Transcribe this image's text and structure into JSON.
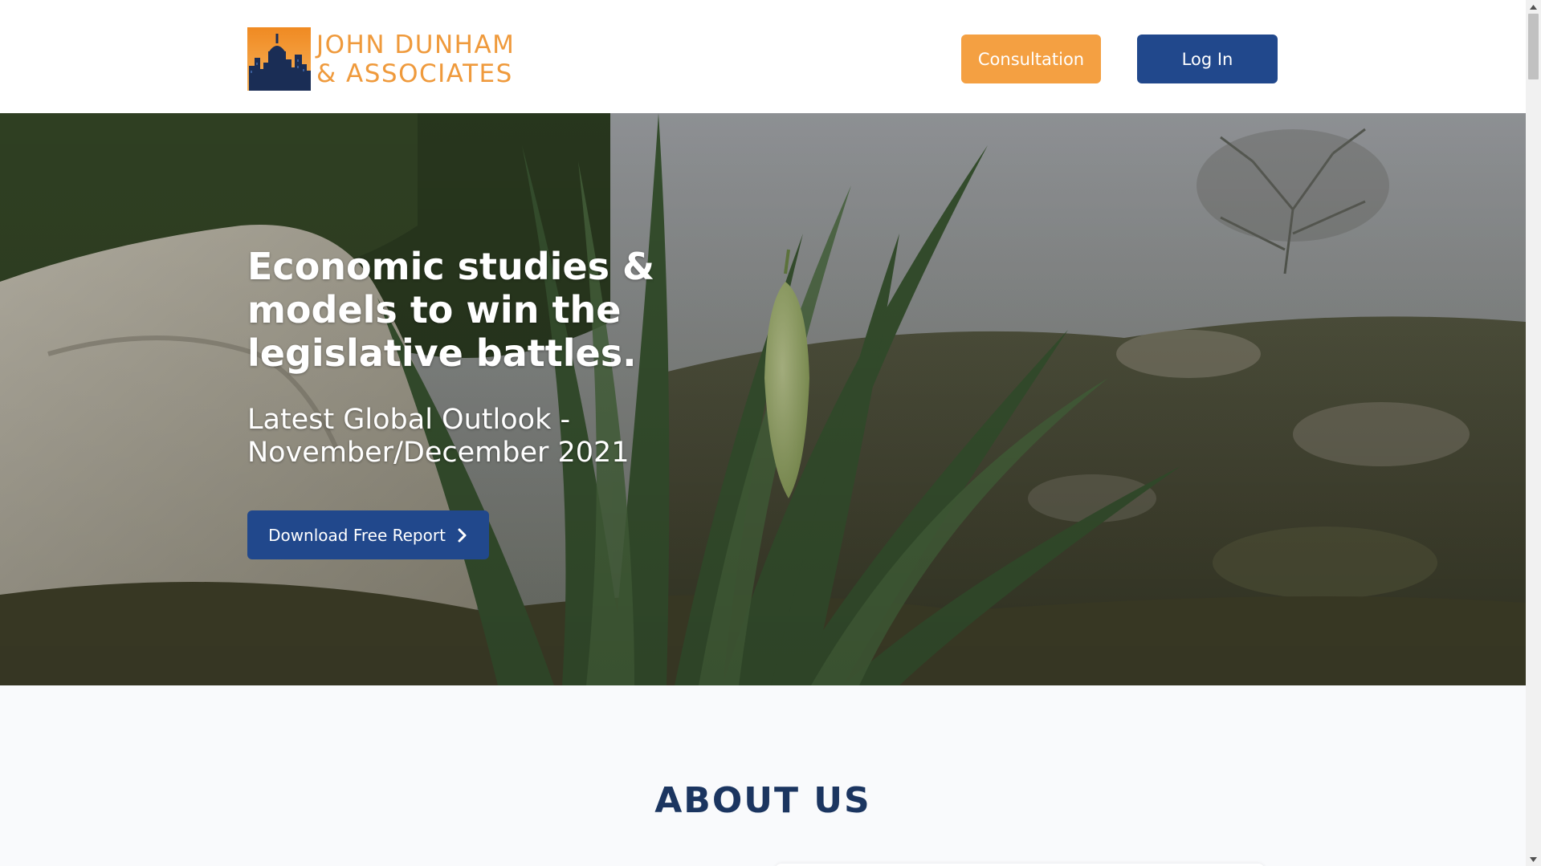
{
  "header": {
    "logo": {
      "line1": "JOHN DUNHAM",
      "line2": "& ASSOCIATES"
    },
    "consultation_label": "Consultation",
    "login_label": "Log In"
  },
  "hero": {
    "title": "Economic studies & models to win the legislative battles.",
    "subtitle": "Latest Global Outlook - November/December 2021",
    "download_label": "Download Free Report"
  },
  "about": {
    "title": "ABOUT US"
  },
  "colors": {
    "brand_orange": "#f4a042",
    "brand_blue": "#21488c",
    "logo_text": "#ef9a3c",
    "heading_navy": "#1b3560",
    "page_background": "#f9fafc"
  },
  "icons": {
    "download_chevron": "chevron-right-icon",
    "logo_mark": "city-skyline-icon"
  }
}
